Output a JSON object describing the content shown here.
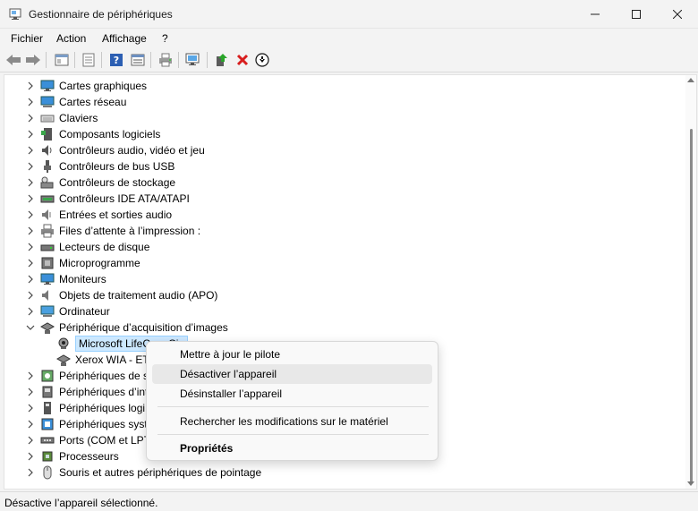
{
  "window": {
    "title": "Gestionnaire de périphériques"
  },
  "menu": [
    "Fichier",
    "Action",
    "Affichage",
    "?"
  ],
  "toolbar": [
    "back-icon",
    "forward-icon",
    "properties-view-icon",
    "details-icon",
    "help-icon",
    "resources-icon",
    "print-icon",
    "scan-hardware-icon",
    "update-driver-icon",
    "uninstall-icon",
    "disable-icon"
  ],
  "tree": {
    "categories": [
      "Cartes graphiques",
      "Cartes réseau",
      "Claviers",
      "Composants logiciels",
      "Contrôleurs audio, vidéo et jeu",
      "Contrôleurs de bus USB",
      "Contrôleurs de stockage",
      "Contrôleurs IDE ATA/ATAPI",
      "Entrées et sorties audio",
      "Files d’attente à l’impression :",
      "Lecteurs de disque",
      "Microprogramme",
      "Moniteurs",
      "Objets de traitement audio (APO)",
      "Ordinateur",
      "Périphérique d’acquisition d’images"
    ],
    "children": [
      "Microsoft LifeCam Cin",
      "Xerox WIA - ET"
    ],
    "categories_after": [
      "Périphériques de s",
      "Périphériques d’int",
      "Périphériques logi",
      "Périphériques syste",
      "Ports (COM et LPT",
      "Processeurs",
      "Souris et autres périphériques de pointage"
    ]
  },
  "context_menu": {
    "update_driver": "Mettre à jour le pilote",
    "disable_device": "Désactiver l’appareil",
    "uninstall_device": "Désinstaller l’appareil",
    "scan_changes": "Rechercher les modifications sur le matériel",
    "properties": "Propriétés"
  },
  "status": {
    "text": "Désactive l’appareil sélectionné."
  }
}
